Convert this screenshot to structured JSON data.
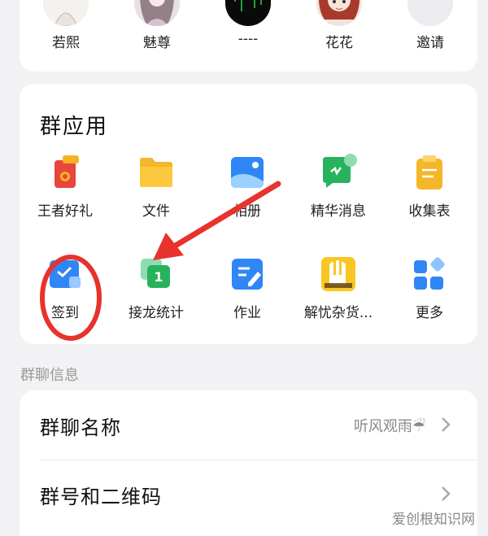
{
  "members": [
    {
      "name": "若熙",
      "avatar": "avatar-girl-icon"
    },
    {
      "name": "魅尊",
      "avatar": "avatar-anime-icon"
    },
    {
      "name": "----",
      "avatar": "avatar-matrix-icon"
    },
    {
      "name": "花花",
      "avatar": "avatar-doll-icon"
    },
    {
      "name": "邀请",
      "avatar": "plus-icon"
    }
  ],
  "apps_section": {
    "title": "群应用",
    "items": [
      {
        "label": "王者好礼",
        "icon": "gift-icon"
      },
      {
        "label": "文件",
        "icon": "folder-icon"
      },
      {
        "label": "相册",
        "icon": "photo-album-icon"
      },
      {
        "label": "精华消息",
        "icon": "essence-message-icon"
      },
      {
        "label": "收集表",
        "icon": "clipboard-icon"
      },
      {
        "label": "签到",
        "icon": "check-in-icon"
      },
      {
        "label": "接龙统计",
        "icon": "relay-count-icon"
      },
      {
        "label": "作业",
        "icon": "homework-icon"
      },
      {
        "label": "解忧杂货...",
        "icon": "grocery-icon"
      },
      {
        "label": "更多",
        "icon": "more-apps-icon"
      }
    ]
  },
  "info_section": {
    "label": "群聊信息",
    "rows": [
      {
        "label": "群聊名称",
        "value": "听风观雨☔"
      },
      {
        "label": "群号和二维码",
        "value": ""
      }
    ]
  },
  "watermark": "爱创根知识网",
  "colors": {
    "background": "#f2f2f5",
    "card": "#ffffff",
    "annotation_red": "#e8322c",
    "icon_blue": "#2f86f6",
    "icon_green": "#27b35c",
    "icon_yellow": "#f5b72a"
  }
}
